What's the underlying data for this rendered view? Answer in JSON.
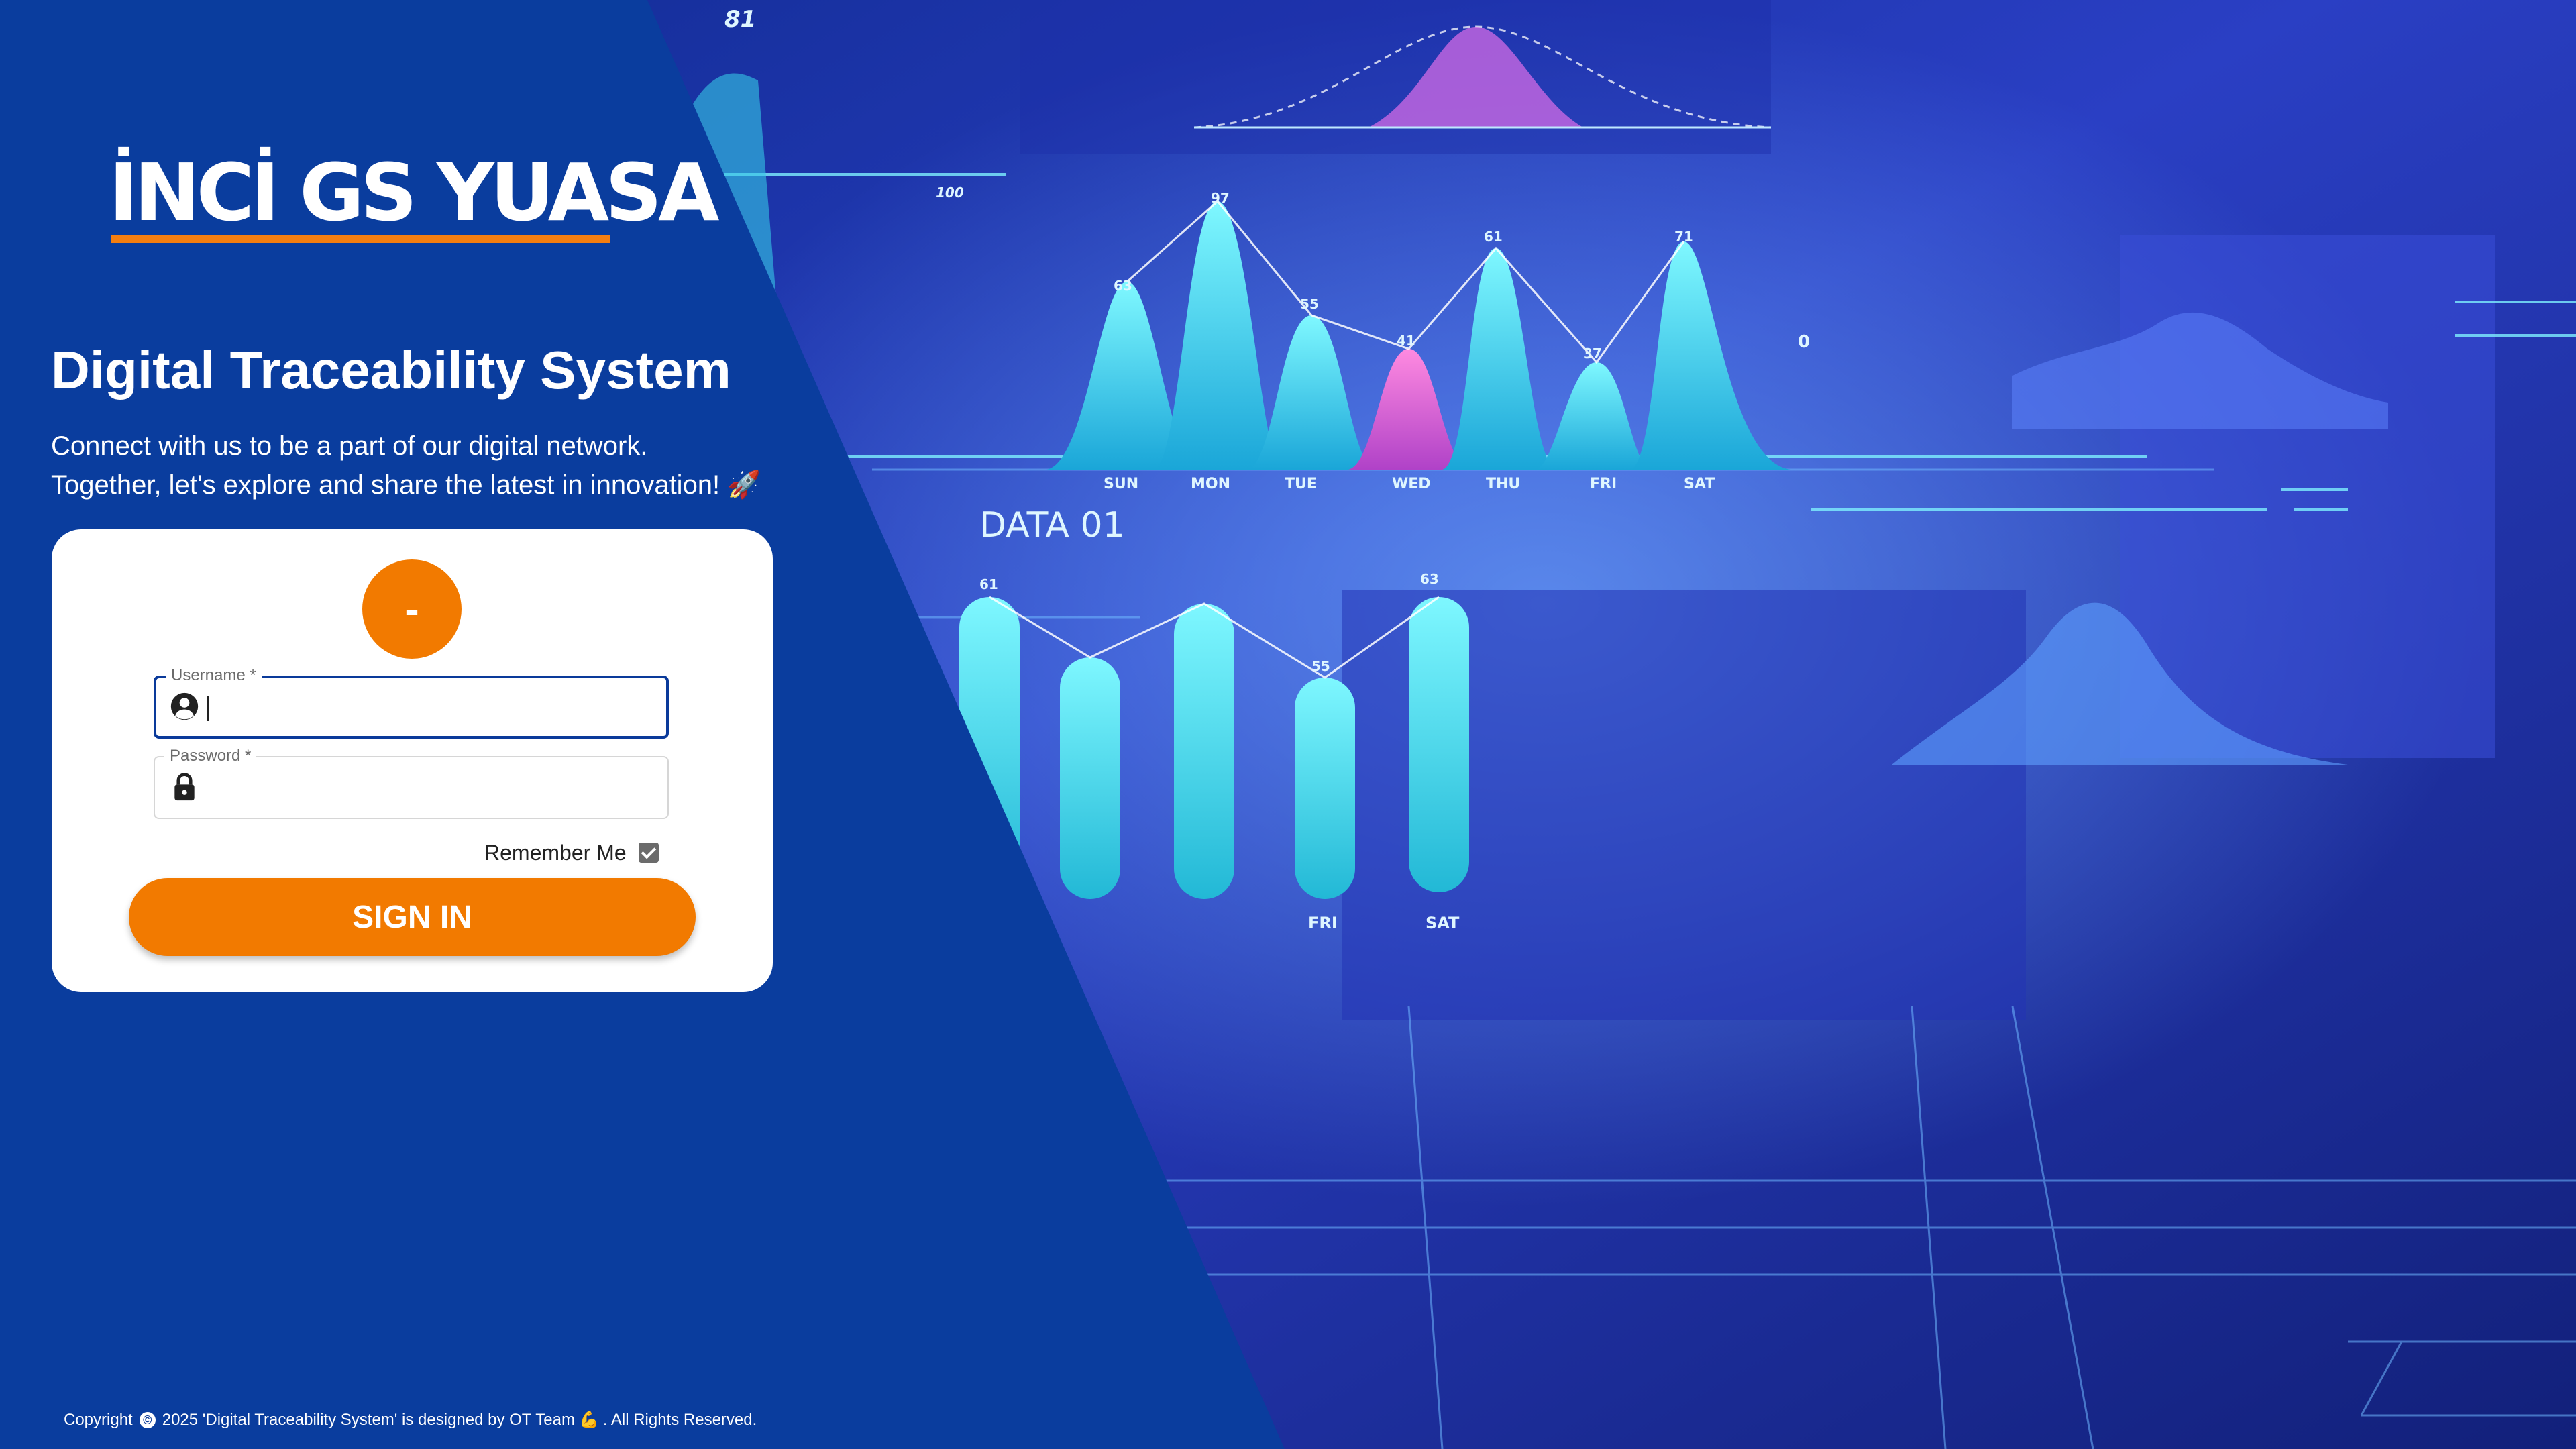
{
  "brand": {
    "logo_text": "İNCİ GS YUASA",
    "accent_color": "#f57e0f"
  },
  "hero": {
    "title": "Digital Traceability System",
    "subtitle_line1": "Connect with us to be a part of our digital network.",
    "subtitle_line2": "Together, let's explore and share the latest in innovation! 🚀"
  },
  "login": {
    "avatar_text": "-",
    "username_label": "Username *",
    "username_value": "",
    "username_icon": "user-circle-icon",
    "password_label": "Password *",
    "password_value": "",
    "password_icon": "lock-icon",
    "remember_label": "Remember Me",
    "remember_checked": true,
    "signin_label": "SIGN IN"
  },
  "background_art": {
    "top_number": "81",
    "data_label": "DATA 01",
    "day_labels": [
      "SUN",
      "MON",
      "TUE",
      "WED",
      "THU",
      "FRI",
      "SAT"
    ],
    "peak_labels": [
      "63",
      "97",
      "55",
      "41",
      "61",
      "37",
      "71"
    ],
    "bar_labels": [
      "61",
      "55",
      "63"
    ],
    "bottom_days": [
      "FRI",
      "SAT"
    ],
    "scale_label": "100",
    "side_number": "0"
  },
  "footer": {
    "prefix": "Copyright",
    "copy_symbol": "©",
    "text": "2025 'Digital Traceability System' is designed by OT Team",
    "emoji": "💪",
    "suffix": ". All Rights Reserved."
  },
  "colors": {
    "panel_blue": "#0a3d9e",
    "button_orange": "#f27a00",
    "card_white": "#ffffff"
  }
}
